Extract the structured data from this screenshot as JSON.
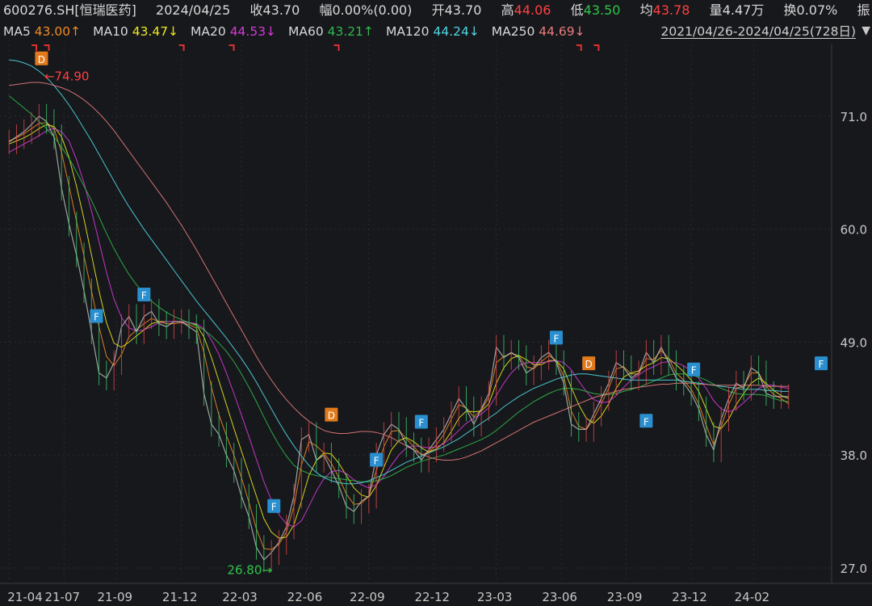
{
  "header": {
    "code": "600276.SH",
    "name": "[恒瑞医药]",
    "date": "2024/04/25",
    "close_label": "收",
    "close": "43.70",
    "change_label": "幅",
    "change": "0.00%(0.00)",
    "open_label": "开",
    "open": "43.70",
    "high_label": "高",
    "high": "44.06",
    "low_label": "低",
    "low": "43.50",
    "avg_label": "均",
    "avg": "43.78",
    "vol_label": "量",
    "vol": "4.47万",
    "turnover_label": "换",
    "turnover": "0.07%",
    "amp_label": "振"
  },
  "ma_bar": {
    "items": [
      {
        "label": "MA5",
        "value": "43.00↑",
        "color": "#f08a24"
      },
      {
        "label": "MA10",
        "value": "43.47↓",
        "color": "#e8e820"
      },
      {
        "label": "MA20",
        "value": "44.53↓",
        "color": "#d63ad8"
      },
      {
        "label": "MA60",
        "value": "43.21↑",
        "color": "#2fb84a"
      },
      {
        "label": "MA120",
        "value": "44.24↓",
        "color": "#4fd6e0"
      },
      {
        "label": "MA250",
        "value": "44.69↓",
        "color": "#e87c7c"
      }
    ],
    "range": "2021/04/26-2024/04/25(728日)"
  },
  "chart_data": {
    "type": "line",
    "title": "",
    "ylim": [
      25.5,
      78
    ],
    "y_ticks": [
      27.0,
      38.0,
      49.0,
      60.0,
      71.0
    ],
    "y_tick_labels": [
      "27.0",
      "38.0",
      "49.0",
      "60.0",
      "71.0"
    ],
    "x_ticks": [
      "21-04",
      "21-07",
      "21-09",
      "21-12",
      "22-03",
      "22-06",
      "22-09",
      "22-12",
      "23-03",
      "23-06",
      "23-09",
      "23-12",
      "24-02"
    ],
    "x_tick_index": [
      0,
      2.2,
      4.3,
      6.9,
      9.3,
      11.9,
      14.4,
      17.0,
      19.5,
      22.1,
      24.7,
      27.3,
      29.8
    ],
    "x_domain": [
      -0.2,
      32.5
    ],
    "max_price": 74.9,
    "max_index": 1.35,
    "min_price": 26.8,
    "min_index": 10.8,
    "close_series": {
      "name": "price",
      "x": [
        0,
        0.3,
        0.6,
        0.9,
        1.2,
        1.5,
        1.8,
        2.1,
        2.4,
        2.7,
        3.0,
        3.3,
        3.6,
        3.9,
        4.2,
        4.5,
        4.8,
        5.1,
        5.4,
        5.7,
        6.0,
        6.3,
        6.6,
        6.9,
        7.2,
        7.5,
        7.8,
        8.1,
        8.4,
        8.7,
        9.0,
        9.3,
        9.6,
        9.9,
        10.2,
        10.5,
        10.8,
        11.1,
        11.4,
        11.7,
        12.0,
        12.3,
        12.6,
        12.9,
        13.2,
        13.5,
        13.8,
        14.1,
        14.4,
        14.7,
        15.0,
        15.3,
        15.6,
        15.9,
        16.2,
        16.5,
        16.8,
        17.1,
        17.4,
        17.7,
        18.0,
        18.3,
        18.6,
        18.9,
        19.2,
        19.5,
        19.8,
        20.1,
        20.4,
        20.7,
        21.0,
        21.3,
        21.6,
        21.9,
        22.2,
        22.5,
        22.8,
        23.1,
        23.4,
        23.7,
        24.0,
        24.3,
        24.6,
        24.9,
        25.2,
        25.5,
        25.8,
        26.1,
        26.4,
        26.7,
        27.0,
        27.3,
        27.6,
        27.9,
        28.2,
        28.5,
        28.8,
        29.1,
        29.4,
        29.7,
        30.0,
        30.3,
        30.6,
        30.9,
        31.2
      ],
      "values": [
        68.5,
        69.0,
        69.5,
        70.2,
        71.0,
        70.5,
        69.0,
        64.0,
        60.5,
        57.5,
        54.0,
        50.0,
        46.0,
        45.5,
        47.0,
        50.5,
        51.5,
        50.0,
        51.5,
        52.0,
        50.8,
        50.5,
        51.0,
        51.0,
        50.5,
        50.0,
        44.0,
        41.0,
        40.0,
        38.0,
        36.5,
        34.0,
        32.0,
        29.0,
        27.8,
        28.5,
        29.5,
        31.0,
        34.0,
        39.5,
        40.0,
        37.5,
        38.0,
        36.5,
        35.0,
        33.0,
        32.5,
        33.5,
        34.0,
        38.0,
        40.0,
        41.0,
        40.5,
        39.0,
        38.5,
        37.5,
        38.5,
        39.5,
        40.5,
        42.0,
        43.5,
        42.5,
        41.0,
        42.5,
        44.0,
        48.5,
        47.5,
        48.0,
        47.5,
        46.0,
        46.5,
        47.5,
        48.0,
        47.0,
        45.0,
        41.0,
        40.5,
        40.5,
        42.0,
        43.5,
        45.0,
        47.0,
        46.5,
        45.5,
        46.0,
        48.0,
        47.0,
        48.5,
        47.0,
        45.5,
        45.0,
        44.0,
        42.5,
        40.0,
        38.5,
        41.5,
        43.5,
        45.0,
        44.5,
        46.5,
        46.0,
        44.0,
        43.7,
        43.7,
        43.7
      ]
    },
    "series": [
      {
        "name": "MA5",
        "color": "#f08a24",
        "values": [
          68.6,
          68.9,
          69.3,
          69.8,
          70.3,
          70.4,
          69.8,
          67.5,
          64.2,
          60.8,
          57.4,
          54.0,
          50.5,
          47.6,
          46.7,
          47.8,
          49.5,
          50.2,
          50.8,
          51.3,
          51.0,
          50.8,
          50.8,
          50.9,
          50.7,
          50.4,
          48.0,
          44.6,
          41.9,
          39.9,
          38.0,
          35.8,
          33.4,
          30.8,
          28.9,
          28.8,
          29.3,
          30.5,
          33.0,
          37.0,
          39.3,
          38.9,
          38.2,
          37.2,
          35.8,
          34.2,
          33.2,
          33.3,
          34.0,
          36.5,
          38.8,
          40.3,
          40.4,
          39.6,
          38.8,
          38.0,
          38.3,
          39.0,
          40.0,
          41.5,
          42.9,
          42.6,
          41.7,
          42.4,
          43.6,
          47.0,
          47.6,
          47.9,
          47.7,
          46.6,
          46.4,
          47.1,
          47.7,
          47.2,
          45.7,
          42.3,
          40.8,
          40.5,
          41.5,
          43.0,
          44.5,
          46.4,
          46.6,
          45.9,
          45.9,
          47.4,
          47.3,
          48.2,
          47.4,
          46.0,
          45.3,
          44.4,
          43.0,
          40.9,
          39.0,
          40.8,
          42.9,
          44.5,
          44.7,
          46.0,
          46.0,
          44.7,
          43.9,
          43.5,
          43.0
        ]
      },
      {
        "name": "MA10",
        "color": "#e8e820",
        "values": [
          68.3,
          68.6,
          68.9,
          69.3,
          69.8,
          70.2,
          70.0,
          69.0,
          67.0,
          64.2,
          61.0,
          57.5,
          54.0,
          50.9,
          48.9,
          48.5,
          49.0,
          49.6,
          50.2,
          50.8,
          51.0,
          51.0,
          51.0,
          51.0,
          50.9,
          50.7,
          49.5,
          47.5,
          45.2,
          42.9,
          40.6,
          38.4,
          36.2,
          34.0,
          31.8,
          30.5,
          29.9,
          30.0,
          31.2,
          33.5,
          36.0,
          37.5,
          38.2,
          38.1,
          37.2,
          36.0,
          34.8,
          34.1,
          33.9,
          35.0,
          36.8,
          38.5,
          39.4,
          39.7,
          39.3,
          38.7,
          38.3,
          38.6,
          39.2,
          40.3,
          41.6,
          42.3,
          42.2,
          42.3,
          43.0,
          45.0,
          46.5,
          47.4,
          47.7,
          47.3,
          46.8,
          46.8,
          47.2,
          47.2,
          46.4,
          44.6,
          42.9,
          41.6,
          41.1,
          41.8,
          43.0,
          44.5,
          45.6,
          46.0,
          46.2,
          46.7,
          47.0,
          47.5,
          47.4,
          46.8,
          46.1,
          45.3,
          44.2,
          42.5,
          40.8,
          40.6,
          41.5,
          42.9,
          44.0,
          45.0,
          45.5,
          45.0,
          44.3,
          43.8,
          43.5
        ]
      },
      {
        "name": "MA20",
        "color": "#d63ad8",
        "values": [
          67.5,
          67.9,
          68.3,
          68.7,
          69.1,
          69.6,
          69.8,
          69.5,
          68.6,
          66.8,
          64.5,
          61.8,
          58.8,
          55.8,
          53.2,
          51.4,
          50.4,
          50.1,
          50.2,
          50.5,
          50.9,
          51.0,
          51.0,
          51.0,
          50.9,
          50.8,
          50.3,
          49.2,
          47.8,
          46.0,
          44.0,
          41.9,
          39.8,
          37.6,
          35.4,
          33.6,
          32.2,
          31.3,
          31.0,
          31.6,
          33.0,
          34.5,
          35.7,
          36.4,
          36.5,
          36.2,
          35.6,
          35.1,
          34.8,
          35.1,
          35.9,
          37.0,
          38.0,
          38.7,
          38.9,
          38.8,
          38.7,
          38.8,
          39.1,
          39.7,
          40.4,
          41.1,
          41.6,
          42.0,
          42.6,
          43.8,
          45.0,
          46.0,
          46.7,
          47.0,
          47.0,
          47.0,
          47.1,
          47.2,
          47.0,
          46.3,
          45.2,
          44.2,
          43.4,
          43.1,
          43.2,
          43.8,
          44.6,
          45.3,
          45.8,
          46.3,
          46.6,
          47.0,
          47.1,
          47.0,
          46.7,
          46.2,
          45.5,
          44.5,
          43.3,
          42.5,
          42.2,
          42.5,
          43.1,
          43.8,
          44.5,
          44.8,
          44.8,
          44.6,
          44.5
        ]
      },
      {
        "name": "MA60",
        "color": "#2fb84a",
        "values": [
          73.0,
          72.4,
          71.8,
          71.2,
          70.5,
          69.8,
          69.0,
          68.0,
          66.9,
          65.6,
          64.2,
          62.8,
          61.2,
          59.6,
          58.1,
          56.8,
          55.6,
          54.6,
          53.7,
          53.0,
          52.4,
          51.9,
          51.5,
          51.2,
          50.9,
          50.6,
          50.2,
          49.6,
          48.9,
          48.1,
          47.1,
          45.9,
          44.6,
          43.2,
          41.7,
          40.3,
          39.0,
          37.9,
          37.0,
          36.5,
          36.2,
          36.0,
          35.9,
          35.8,
          35.7,
          35.6,
          35.5,
          35.4,
          35.4,
          35.5,
          35.7,
          36.0,
          36.4,
          36.8,
          37.1,
          37.4,
          37.6,
          37.8,
          38.0,
          38.3,
          38.6,
          38.9,
          39.2,
          39.5,
          39.9,
          40.4,
          41.0,
          41.6,
          42.2,
          42.7,
          43.2,
          43.6,
          44.0,
          44.3,
          44.5,
          44.5,
          44.4,
          44.2,
          44.0,
          43.9,
          43.9,
          44.0,
          44.2,
          44.4,
          44.6,
          44.9,
          45.2,
          45.5,
          45.8,
          45.9,
          45.9,
          45.8,
          45.6,
          45.3,
          44.9,
          44.5,
          44.2,
          44.0,
          43.9,
          43.9,
          43.9,
          43.8,
          43.5,
          43.3,
          43.2
        ]
      },
      {
        "name": "MA120",
        "color": "#4fd6e0",
        "values": [
          76.5,
          76.4,
          76.2,
          75.9,
          75.4,
          74.8,
          74.0,
          73.1,
          72.1,
          71.0,
          69.8,
          68.6,
          67.3,
          66.0,
          64.7,
          63.4,
          62.2,
          61.1,
          60.0,
          59.0,
          58.0,
          57.0,
          56.0,
          55.0,
          54.0,
          53.0,
          52.1,
          51.2,
          50.3,
          49.4,
          48.4,
          47.4,
          46.3,
          45.1,
          43.8,
          42.5,
          41.2,
          40.0,
          38.9,
          37.9,
          37.0,
          36.3,
          35.8,
          35.5,
          35.3,
          35.2,
          35.2,
          35.3,
          35.5,
          35.8,
          36.1,
          36.5,
          36.9,
          37.3,
          37.6,
          37.9,
          38.2,
          38.5,
          38.8,
          39.2,
          39.6,
          40.1,
          40.6,
          41.1,
          41.6,
          42.1,
          42.7,
          43.2,
          43.7,
          44.1,
          44.5,
          44.8,
          45.1,
          45.4,
          45.6,
          45.8,
          45.9,
          45.9,
          45.8,
          45.7,
          45.6,
          45.5,
          45.4,
          45.3,
          45.3,
          45.3,
          45.3,
          45.3,
          45.3,
          45.3,
          45.2,
          45.1,
          45.0,
          44.9,
          44.8,
          44.7,
          44.6,
          44.5,
          44.4,
          44.4,
          44.4,
          44.3,
          44.3,
          44.2,
          44.2
        ]
      },
      {
        "name": "MA250",
        "color": "#e87c7c",
        "values": [
          74.0,
          74.1,
          74.2,
          74.3,
          74.3,
          74.2,
          74.0,
          73.8,
          73.5,
          73.1,
          72.6,
          72.0,
          71.3,
          70.5,
          69.6,
          68.6,
          67.6,
          66.6,
          65.6,
          64.6,
          63.6,
          62.6,
          61.5,
          60.4,
          59.2,
          58.0,
          56.7,
          55.4,
          54.1,
          52.8,
          51.5,
          50.2,
          48.9,
          47.6,
          46.4,
          45.3,
          44.3,
          43.4,
          42.6,
          41.9,
          41.3,
          40.8,
          40.4,
          40.2,
          40.1,
          40.1,
          40.2,
          40.3,
          40.3,
          40.2,
          40.0,
          39.7,
          39.3,
          38.9,
          38.5,
          38.1,
          37.8,
          37.6,
          37.5,
          37.5,
          37.6,
          37.8,
          38.1,
          38.4,
          38.8,
          39.2,
          39.6,
          40.0,
          40.4,
          40.8,
          41.2,
          41.5,
          41.8,
          42.1,
          42.4,
          42.7,
          43.0,
          43.3,
          43.6,
          43.8,
          44.0,
          44.2,
          44.4,
          44.5,
          44.6,
          44.7,
          44.8,
          44.9,
          44.9,
          45.0,
          45.0,
          45.0,
          44.9,
          44.9,
          44.8,
          44.8,
          44.8,
          44.8,
          44.8,
          44.8,
          44.8,
          44.7,
          44.7,
          44.7,
          44.7
        ]
      }
    ],
    "markers": [
      {
        "label": "D",
        "x": 1.3,
        "price": 76.6,
        "color": "#e07a1c"
      },
      {
        "label": "F",
        "x": 3.5,
        "price": 51.5,
        "color": "#2a8fcf"
      },
      {
        "label": "F",
        "x": 5.4,
        "price": 53.6,
        "color": "#2a8fcf"
      },
      {
        "label": "F",
        "x": 10.6,
        "price": 33.0,
        "color": "#2a8fcf"
      },
      {
        "label": "D",
        "x": 12.9,
        "price": 41.9,
        "color": "#e07a1c"
      },
      {
        "label": "F",
        "x": 14.7,
        "price": 37.5,
        "color": "#2a8fcf"
      },
      {
        "label": "F",
        "x": 16.5,
        "price": 41.2,
        "color": "#2a8fcf"
      },
      {
        "label": "F",
        "x": 21.9,
        "price": 49.4,
        "color": "#2a8fcf"
      },
      {
        "label": "D",
        "x": 23.2,
        "price": 46.9,
        "color": "#e07a1c"
      },
      {
        "label": "F",
        "x": 25.5,
        "price": 41.3,
        "color": "#2a8fcf"
      },
      {
        "label": "F",
        "x": 27.4,
        "price": 46.3,
        "color": "#2a8fcf"
      },
      {
        "label": "F",
        "x": 32.5,
        "price": 46.9,
        "color": "#2a8fcf"
      }
    ],
    "top_flags_x": [
      0.9,
      1.4,
      6.8,
      8.8,
      13.0,
      22.7,
      23.4
    ],
    "max_label": "←74.90",
    "min_label": "26.80→"
  }
}
